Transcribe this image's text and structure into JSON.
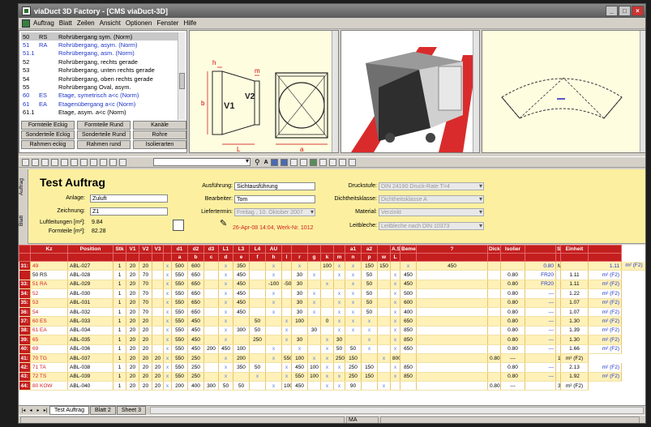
{
  "title": "viaDuct 3D Factory - [CMS viaDuct-3D]",
  "menu": [
    "Auftrag",
    "Blatt",
    "Zeilen",
    "Ansicht",
    "Optionen",
    "Fenster",
    "Hilfe"
  ],
  "partlist": [
    {
      "n": "50",
      "c": "RS",
      "t": "Rohrübergang sym. (Norm)",
      "blue": false,
      "sel": true
    },
    {
      "n": "51",
      "c": "RA",
      "t": "Rohrübergang, asym. (Norm)",
      "blue": true,
      "sel": false
    },
    {
      "n": "51.1",
      "c": "",
      "t": "Rohrübergang, asm. (Norm)",
      "blue": true,
      "sel": false
    },
    {
      "n": "52",
      "c": "",
      "t": "Rohrübergang, rechts gerade",
      "blue": false,
      "sel": false
    },
    {
      "n": "53",
      "c": "",
      "t": "Rohrübergang, unten rechts gerade",
      "blue": false,
      "sel": false
    },
    {
      "n": "54",
      "c": "",
      "t": "Rohrübergang, oben rechts gerade",
      "blue": false,
      "sel": false
    },
    {
      "n": "55",
      "c": "",
      "t": "Rohrübergang Oval, asym.",
      "blue": false,
      "sel": false
    },
    {
      "n": "60",
      "c": "ES",
      "t": "Etage, symetrisch a<c (Norm)",
      "blue": true,
      "sel": false
    },
    {
      "n": "61",
      "c": "EA",
      "t": "Etagenübergang a<c (Norm)",
      "blue": true,
      "sel": false
    },
    {
      "n": "61.1",
      "c": "",
      "t": "Etage, asym. a<c (Norm)",
      "blue": false,
      "sel": false
    }
  ],
  "partbuttons": [
    "Formteile Eckig",
    "Formteile Rund",
    "Kanäle",
    "Sonderteile Eckig",
    "Sonderteile Rund",
    "Rohre",
    "Rahmen eckig",
    "Rahmen rund",
    "Isolierarten"
  ],
  "dims": {
    "h": "h",
    "m": "m",
    "V1": "V1",
    "V2": "V2",
    "b": "b",
    "L": "L",
    "a": "a"
  },
  "form": {
    "vtabs": [
      "Auftrag",
      "Blatt"
    ],
    "title": "Test Auftrag",
    "anlage_label": "Anlage:",
    "anlage": "Zuluft",
    "zeichnung_label": "Zeichnung:",
    "zeichnung": "Z1",
    "luft_label": "Luftleitungen [m²]:",
    "luft": "9.84",
    "form_label": "Formteile [m²]:",
    "form": "82.28",
    "ausfuehrung_label": "Ausführung:",
    "ausfuehrung": "Sichtausführung",
    "bearbeiter_label": "Bearbeiter:",
    "bearbeiter": "Tom",
    "liefer_label": "Liefertermin:",
    "liefer": "Freitag , 10. Oktober 2007",
    "datum": "26-Apr-08 14:04, Werk-Nr. 1012",
    "druck_label": "Druckstufe:",
    "druck": "DIN 24190 Druck-Rate T=4",
    "dicht_label": "Dichtheitsklasse:",
    "dicht": "Dichtheitsklasse A",
    "material_label": "Material:",
    "material": "Verzinkt",
    "leit_label": "Leitbleche:",
    "leit": "Leitbleche nach DIN 10373"
  },
  "table": {
    "headers": [
      "",
      "Kz",
      "Position",
      "Stk",
      "V1",
      "V2",
      "V3",
      "",
      "d1",
      "d2",
      "d3",
      "L1",
      "L3",
      "L4",
      "AU",
      "",
      "",
      "",
      "",
      "",
      "a1",
      "a2",
      "",
      "A.S",
      "Bemerkung",
      "?",
      "Dicke",
      "Isolier",
      "",
      "Summe",
      "Einheit"
    ],
    "subheaders": [
      "",
      "",
      "",
      "",
      "",
      "",
      "",
      "",
      "a",
      "b",
      "c",
      "d",
      "e",
      "f",
      "h",
      "l",
      "r",
      "g",
      "k",
      "m",
      "n",
      "p",
      "w",
      "L",
      "",
      "",
      "",
      "",
      "",
      "",
      ""
    ],
    "rows": [
      [
        "31:",
        "49",
        "ABL-027",
        "1",
        "20",
        "20",
        "",
        "x",
        "500",
        "600",
        "",
        "x",
        "350",
        "",
        "x",
        "",
        "x",
        "",
        "100",
        "x",
        "x",
        "150",
        "150",
        "",
        "x",
        "450",
        "",
        "",
        "0.80",
        "MP10",
        "",
        "1.11",
        "m² (F2)"
      ],
      [
        "",
        "50 RS",
        "ABL-028",
        "1",
        "20",
        "70",
        "",
        "x",
        "550",
        "650",
        "",
        "x",
        "450",
        "",
        "x",
        "",
        "30",
        "x",
        "",
        "x",
        "x",
        "50",
        "",
        "x",
        "450",
        "",
        "",
        "0.80",
        "FR20",
        "",
        "1.11",
        "m² (F2)"
      ],
      [
        "33:",
        "51 RA",
        "ABL-029",
        "1",
        "20",
        "70",
        "",
        "x",
        "550",
        "650",
        "",
        "x",
        "450",
        "",
        "-100",
        "-50",
        "30",
        "",
        "x",
        "",
        "x",
        "50",
        "",
        "x",
        "450",
        "",
        "",
        "0.80",
        "FR20",
        "",
        "1.11",
        "m² (F2)"
      ],
      [
        "34:",
        "52",
        "ABL-030",
        "1",
        "20",
        "70",
        "",
        "x",
        "550",
        "650",
        "",
        "x",
        "450",
        "",
        "x",
        "",
        "30",
        "x",
        "",
        "x",
        "x",
        "50",
        "",
        "x",
        "500",
        "",
        "",
        "0.80",
        "---",
        "",
        "1.22",
        "m² (F2)"
      ],
      [
        "35:",
        "53",
        "ABL-031",
        "1",
        "20",
        "70",
        "",
        "x",
        "550",
        "650",
        "",
        "x",
        "450",
        "",
        "x",
        "",
        "30",
        "x",
        "",
        "x",
        "x",
        "50",
        "",
        "x",
        "600",
        "",
        "",
        "0.80",
        "---",
        "",
        "1.07",
        "m² (F2)"
      ],
      [
        "36:",
        "54",
        "ABL-032",
        "1",
        "20",
        "70",
        "",
        "x",
        "550",
        "650",
        "",
        "x",
        "450",
        "",
        "x",
        "",
        "30",
        "x",
        "",
        "x",
        "x",
        "50",
        "",
        "x",
        "400",
        "",
        "",
        "0.80",
        "---",
        "",
        "1.07",
        "m² (F2)"
      ],
      [
        "37:",
        "60 ES",
        "ABL-033",
        "1",
        "20",
        "20",
        "",
        "x",
        "550",
        "450",
        "",
        "x",
        "",
        "50",
        "",
        "x",
        "100",
        "",
        "0",
        "x",
        "x",
        "x",
        "",
        "x",
        "650",
        "",
        "",
        "0.80",
        "---",
        "",
        "1.30",
        "m² (F2)"
      ],
      [
        "38:",
        "61 EA",
        "ABL-034",
        "1",
        "20",
        "20",
        "",
        "x",
        "550",
        "450",
        "",
        "x",
        "300",
        "50",
        "",
        "x",
        "",
        "30",
        "",
        "x",
        "x",
        "x",
        "",
        "x",
        "850",
        "",
        "",
        "0.80",
        "---",
        "",
        "1.39",
        "m² (F2)"
      ],
      [
        "39:",
        "65",
        "ABL-035",
        "1",
        "20",
        "20",
        "",
        "x",
        "550",
        "450",
        "",
        "x",
        "",
        "250",
        "",
        "x",
        "30",
        "",
        "x",
        "30",
        "",
        "x",
        "",
        "x",
        "850",
        "",
        "",
        "0.80",
        "---",
        "",
        "1.30",
        "m² (F2)"
      ],
      [
        "40:",
        "69",
        "ABL-036",
        "1",
        "20",
        "20",
        "",
        "x",
        "550",
        "450",
        "200",
        "450",
        "100",
        "",
        "x",
        "",
        "x",
        "",
        "x",
        "50",
        "50",
        "x",
        "",
        "x",
        "650",
        "",
        "",
        "0.80",
        "---",
        "",
        "1.66",
        "m² (F2)"
      ],
      [
        "41:",
        "70 TG",
        "ABL-037",
        "1",
        "20",
        "20",
        "20",
        "x",
        "550",
        "250",
        "",
        "x",
        "200",
        "",
        "x",
        "550",
        "100",
        "x",
        "x",
        "250",
        "150",
        "",
        "x",
        "800",
        "",
        "",
        "0.80",
        "---",
        "",
        "1.91",
        "m² (F2)"
      ],
      [
        "42:",
        "71 TA",
        "ABL-038",
        "1",
        "20",
        "20",
        "20",
        "x",
        "550",
        "250",
        "",
        "x",
        "350",
        "50",
        "",
        "x",
        "450",
        "100",
        "x",
        "x",
        "250",
        "150",
        "",
        "x",
        "850",
        "",
        "",
        "0.80",
        "---",
        "",
        "2.13",
        "m² (F2)"
      ],
      [
        "43:",
        "72 TS",
        "ABL-039",
        "1",
        "20",
        "20",
        "20",
        "x",
        "550",
        "250",
        "",
        "x",
        "",
        "x",
        "",
        "x",
        "550",
        "100",
        "x",
        "x",
        "250",
        "150",
        "",
        "x",
        "850",
        "",
        "",
        "0.80",
        "---",
        "",
        "1.92",
        "m² (F2)"
      ],
      [
        "44:",
        "80 KOW",
        "ABL-040",
        "1",
        "20",
        "20",
        "20",
        "x",
        "200",
        "400",
        "300",
        "50",
        "50",
        "",
        "x",
        "100",
        "450",
        "",
        "x",
        "x",
        "90",
        "",
        "x",
        "",
        "",
        "",
        "0.80",
        "---",
        "",
        "3.66",
        "m² (F2)"
      ]
    ]
  },
  "sheets": [
    "Test Auftrag",
    "Blatt 2",
    "Sheet 3"
  ],
  "status": "MA"
}
